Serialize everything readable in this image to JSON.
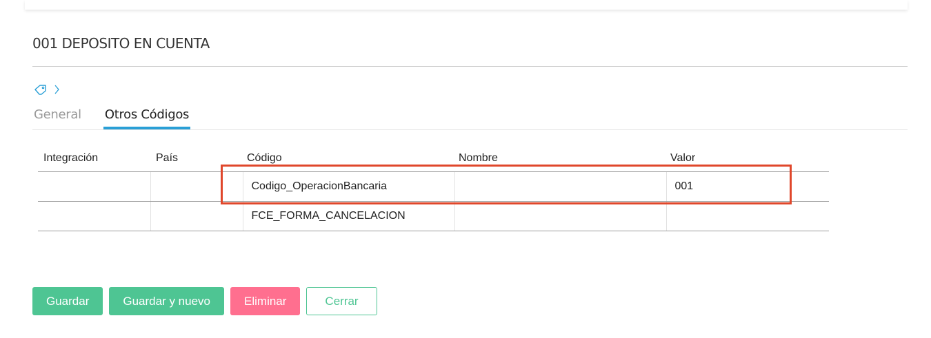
{
  "page": {
    "title": "001 DEPOSITO EN CUENTA"
  },
  "breadcrumb": {
    "icons": [
      "tag-icon",
      "chevron-right-icon"
    ]
  },
  "tabs": [
    {
      "label": "General",
      "active": false
    },
    {
      "label": "Otros Códigos",
      "active": true
    }
  ],
  "table": {
    "columns": [
      "Integración",
      "País",
      "Código",
      "Nombre",
      "Valor"
    ],
    "rows": [
      {
        "integracion": "",
        "pais": "",
        "codigo": "Codigo_OperacionBancaria",
        "nombre": "",
        "valor": "001"
      },
      {
        "integracion": "",
        "pais": "",
        "codigo": "FCE_FORMA_CANCELACION",
        "nombre": "",
        "valor": ""
      }
    ]
  },
  "actions": {
    "save_label": "Guardar",
    "save_new_label": "Guardar y nuevo",
    "delete_label": "Eliminar",
    "close_label": "Cerrar"
  },
  "colors": {
    "accent_green": "#4ec593",
    "danger_pink": "#ff6f8f",
    "tab_underline": "#2a9fd6",
    "highlight_red": "#e0472b"
  }
}
